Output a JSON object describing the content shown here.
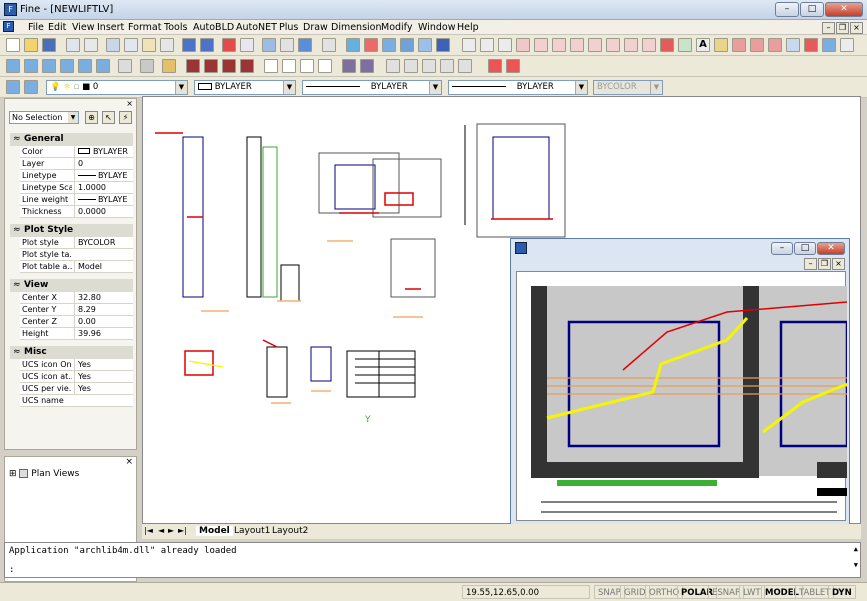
{
  "window": {
    "title": "Fine - [NEWLIFTLV]",
    "min": "–",
    "max": "□",
    "close": "✕"
  },
  "menu": [
    "File",
    "Edit",
    "View",
    "Insert",
    "Format",
    "Tools",
    "AutoBLD",
    "AutoNET",
    "Plus",
    "Draw",
    "Dimension",
    "Modify",
    "Window",
    "Help"
  ],
  "layer_bar": {
    "layer_value": "0",
    "color_value": "BYLAYER",
    "linetype_value": "BYLAYER",
    "lineweight_value": "BYLAYER",
    "plotstyle_value": "BYCOLOR"
  },
  "properties": {
    "selection": "No Selection",
    "sections": [
      {
        "title": "General",
        "rows": [
          [
            "Color",
            "BYLAYER"
          ],
          [
            "Layer",
            "0"
          ],
          [
            "Linetype",
            "BYLAYE"
          ],
          [
            "Linetype Scale",
            "1.0000"
          ],
          [
            "Line weight",
            "BYLAYE"
          ],
          [
            "Thickness",
            "0.0000"
          ]
        ]
      },
      {
        "title": "Plot Style",
        "rows": [
          [
            "Plot style",
            "BYCOLOR"
          ],
          [
            "Plot style ta...",
            ""
          ],
          [
            "Plot table a...",
            "Model"
          ]
        ]
      },
      {
        "title": "View",
        "rows": [
          [
            "Center X",
            "32.80"
          ],
          [
            "Center Y",
            "8.29"
          ],
          [
            "Center Z",
            "0.00"
          ],
          [
            "Height",
            "39.96"
          ]
        ]
      },
      {
        "title": "Misc",
        "rows": [
          [
            "UCS icon On",
            "Yes"
          ],
          [
            "UCS icon at...",
            "Yes"
          ],
          [
            "UCS per vie...",
            "Yes"
          ],
          [
            "UCS name",
            ""
          ]
        ]
      }
    ]
  },
  "tree": {
    "root_toggle": "⊞",
    "root_label": "Plan Views",
    "close": "×"
  },
  "tabs": {
    "nav": [
      "|◄",
      "◄",
      "►",
      "►|"
    ],
    "items": [
      "Model",
      "Layout1",
      "Layout2"
    ]
  },
  "command": {
    "history": "Application \"archlib4m.dll\" already loaded",
    "prompt": ":"
  },
  "status": {
    "coords": "19.55,12.65,0.00",
    "toggles": [
      {
        "label": "SNAP",
        "on": false
      },
      {
        "label": "GRID",
        "on": false
      },
      {
        "label": "ORTHO",
        "on": false
      },
      {
        "label": "POLAR",
        "on": true
      },
      {
        "label": "ESNAP",
        "on": false
      },
      {
        "label": "LWT",
        "on": false
      },
      {
        "label": "MODEL",
        "on": true
      },
      {
        "label": "TABLET",
        "on": false
      },
      {
        "label": "DYN",
        "on": true
      }
    ]
  },
  "canvas": {
    "y_marker": "Y"
  },
  "colors": {
    "accent": "#2a5db0",
    "drawing_red": "#e00000",
    "drawing_yellow": "#f5f500",
    "drawing_blue": "#000080"
  }
}
